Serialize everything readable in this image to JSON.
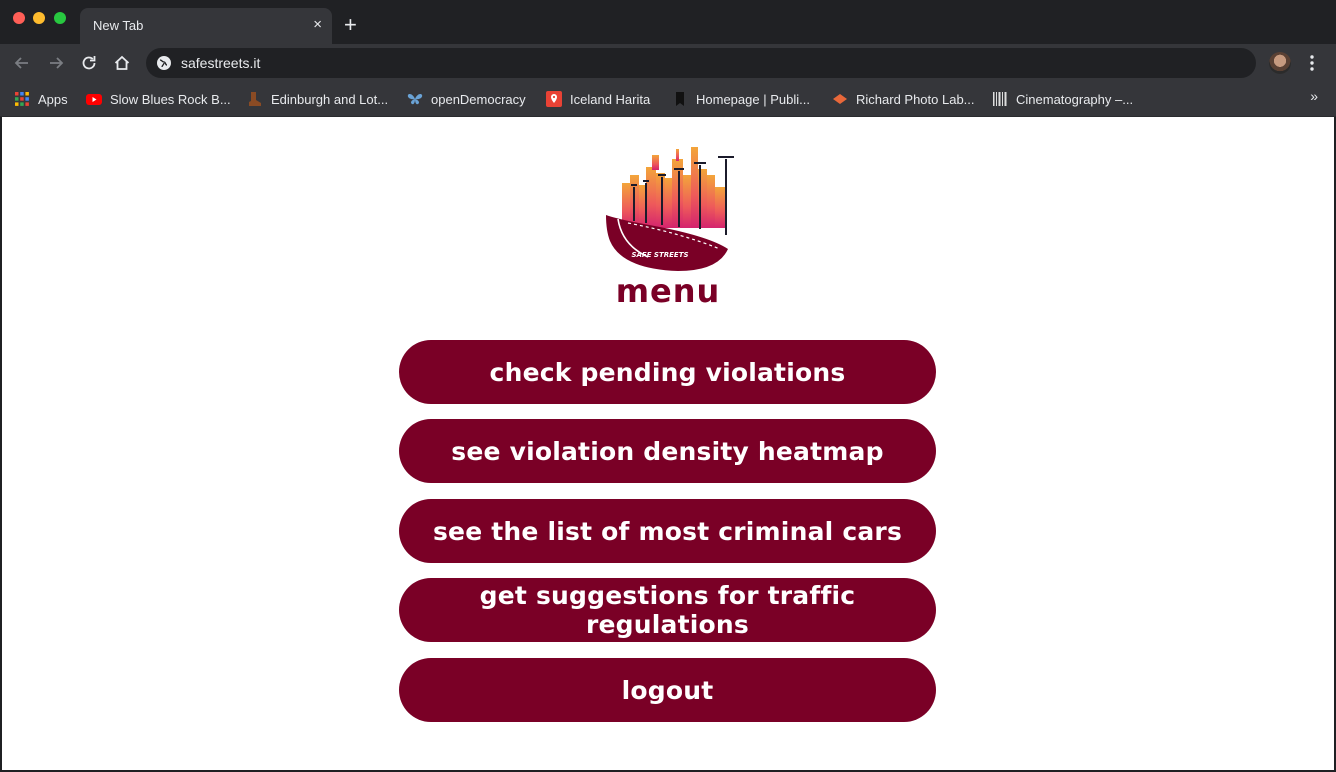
{
  "browser": {
    "tab_title": "New Tab",
    "tab_close": "×",
    "new_tab": "+",
    "url": "safestreets.it",
    "bookmarks": [
      {
        "label": "Apps",
        "icon": "apps-grid-icon"
      },
      {
        "label": "Slow Blues Rock B...",
        "icon": "youtube-icon"
      },
      {
        "label": "Edinburgh and Lot...",
        "icon": "boot-icon"
      },
      {
        "label": "openDemocracy",
        "icon": "butterfly-icon"
      },
      {
        "label": "Iceland Harita",
        "icon": "map-pin-icon"
      },
      {
        "label": "Homepage | Publi...",
        "icon": "bookmark-icon"
      },
      {
        "label": "Richard Photo Lab...",
        "icon": "diamond-icon"
      },
      {
        "label": "Cinematography –...",
        "icon": "barcode-icon"
      }
    ],
    "bookmarks_overflow": "»"
  },
  "page": {
    "logo_text": "SAFE STREETS",
    "title": "menu",
    "buttons": [
      "check pending violations",
      "see violation density heatmap",
      "see the list of most criminal cars",
      "get suggestions for traffic regulations",
      "logout"
    ]
  },
  "colors": {
    "brand": "#7a0026",
    "chrome_dark": "#202124",
    "chrome_toolbar": "#35363a"
  }
}
